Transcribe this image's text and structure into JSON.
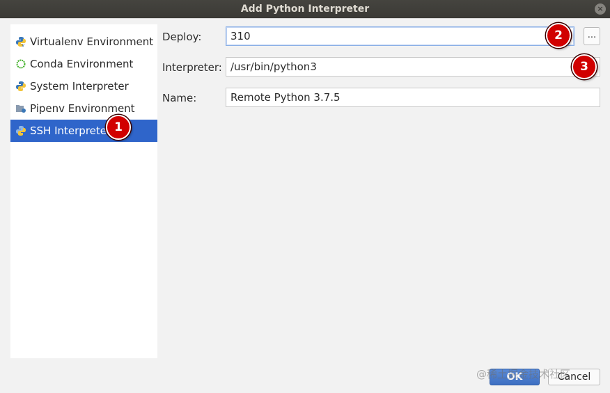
{
  "window": {
    "title": "Add Python Interpreter",
    "close_glyph": "×"
  },
  "sidebar": {
    "items": [
      {
        "label": "Virtualenv Environment",
        "icon": "python-virtualenv-icon"
      },
      {
        "label": "Conda Environment",
        "icon": "conda-ring-icon"
      },
      {
        "label": "System Interpreter",
        "icon": "python-icon"
      },
      {
        "label": "Pipenv Environment",
        "icon": "pipenv-folder-icon"
      },
      {
        "label": "SSH Interpreter",
        "icon": "python-remote-icon",
        "selected": true
      }
    ]
  },
  "form": {
    "deploy_label": "Deploy:",
    "deploy_value": "310",
    "browse_label": "...",
    "interpreter_label": "Interpreter:",
    "interpreter_value": "/usr/bin/python3",
    "name_label": "Name:",
    "name_value": "Remote Python 3.7.5"
  },
  "annotations": {
    "badge1": "1",
    "badge2": "2",
    "badge3": "3",
    "color": "#d10000"
  },
  "buttons": {
    "ok_label": "OK",
    "cancel_label": "Cancel"
  },
  "watermark": "@稀土掘金技术社区",
  "colors": {
    "selection": "#2f65ca",
    "titlebar": "#3b3a36",
    "badge": "#d10000"
  }
}
